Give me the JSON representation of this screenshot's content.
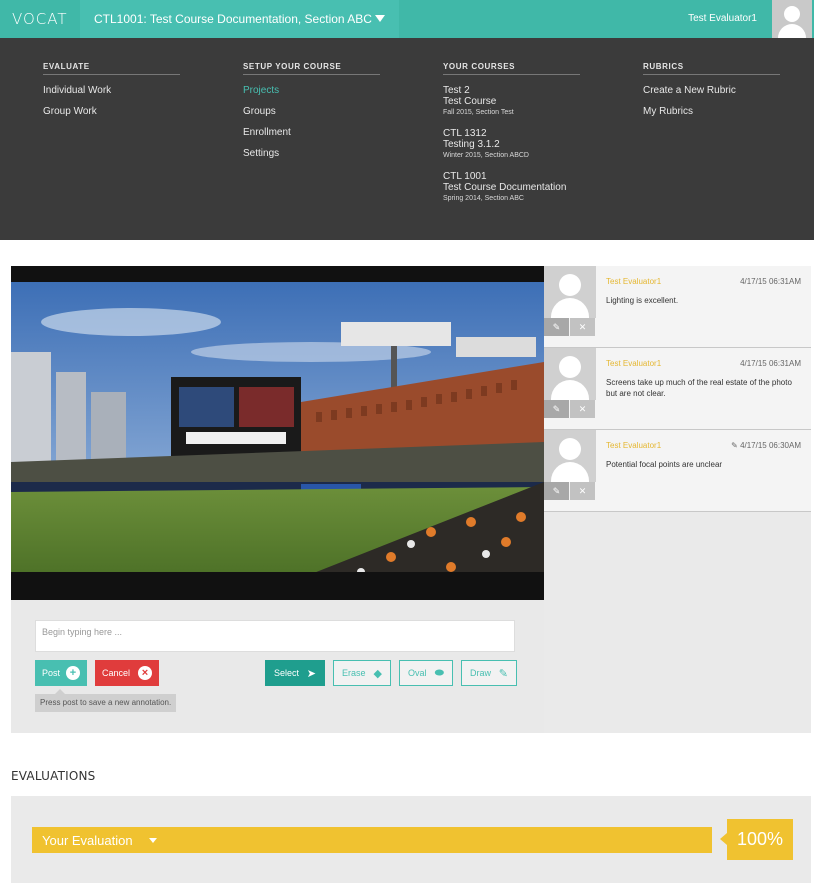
{
  "header": {
    "logo": "VOCAT",
    "course_selector": "CTL1001: Test Course Documentation, Section ABC",
    "user_name": "Test Evaluator1"
  },
  "menu": {
    "evaluate": {
      "heading": "EVALUATE",
      "items": [
        "Individual Work",
        "Group Work"
      ]
    },
    "setup": {
      "heading": "SETUP YOUR COURSE",
      "items": [
        "Projects",
        "Groups",
        "Enrollment",
        "Settings"
      ],
      "active": "Projects"
    },
    "courses": {
      "heading": "YOUR COURSES",
      "items": [
        {
          "code": "Test 2",
          "name": "Test Course",
          "term": "Fall 2015, Section Test"
        },
        {
          "code": "CTL 1312",
          "name": "Testing 3.1.2",
          "term": "Winter 2015, Section ABCD"
        },
        {
          "code": "CTL 1001",
          "name": "Test Course Documentation",
          "term": "Spring 2014, Section ABC"
        }
      ]
    },
    "rubrics": {
      "heading": "RUBRICS",
      "items": [
        "Create a New Rubric",
        "My Rubrics"
      ]
    }
  },
  "annotator": {
    "placeholder": "Begin typing here ...",
    "post_label": "Post",
    "cancel_label": "Cancel",
    "tooltip": "Press post to save a new annotation.",
    "tools": {
      "select": "Select",
      "erase": "Erase",
      "oval": "Oval",
      "draw": "Draw"
    }
  },
  "comments": [
    {
      "author": "Test Evaluator1",
      "date": "4/17/15 06:31AM",
      "text": "Lighting is excellent.",
      "edited": false
    },
    {
      "author": "Test Evaluator1",
      "date": "4/17/15 06:31AM",
      "text": "Screens take up much of the real estate of the photo but are not clear.",
      "edited": false
    },
    {
      "author": "Test Evaluator1",
      "date": "4/17/15 06:30AM",
      "text": "Potential focal points are unclear",
      "edited": true
    }
  ],
  "evaluations": {
    "title": "EVALUATIONS",
    "your_evaluation_label": "Your Evaluation",
    "score": "100%"
  },
  "colors": {
    "teal": "#48bfb1",
    "dark": "#3b3b3b",
    "yellow": "#f0c230",
    "red": "#e03c3c"
  }
}
